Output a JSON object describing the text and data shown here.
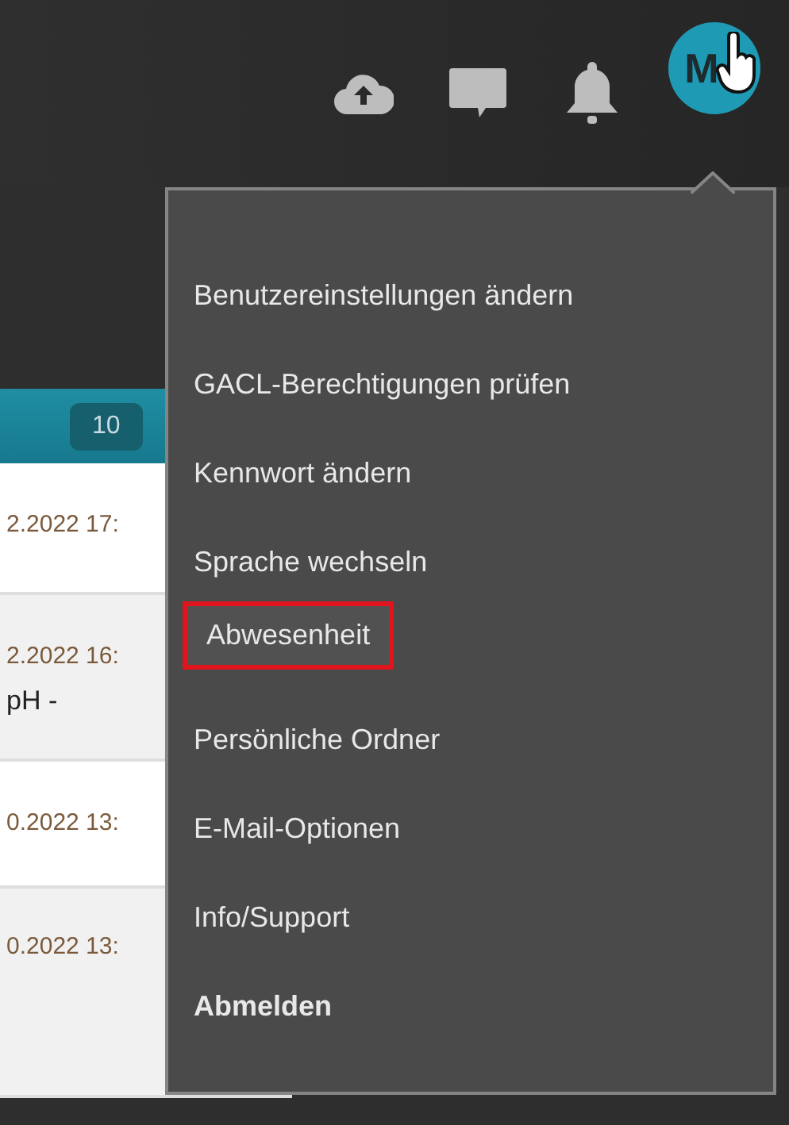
{
  "header": {
    "avatar": {
      "initial": "M"
    }
  },
  "list": {
    "badge": "10",
    "rows": [
      {
        "lines": [
          "2.2022 17:"
        ]
      },
      {
        "lines": [
          "2.2022 16:",
          "pH -"
        ]
      },
      {
        "lines": [
          "0.2022 13:"
        ]
      },
      {
        "lines": [
          "0.2022 13:"
        ]
      }
    ]
  },
  "user_menu": {
    "items": [
      {
        "label": "Benutzereinstellungen ändern",
        "kind": "item",
        "selected": false
      },
      {
        "label": "GACL-Berechtigungen prüfen",
        "kind": "item",
        "selected": false
      },
      {
        "label": "Kennwort ändern",
        "kind": "item",
        "selected": false
      },
      {
        "label": "Sprache wechseln",
        "kind": "item",
        "selected": false
      },
      {
        "label": "Abwesenheit",
        "kind": "item",
        "selected": true
      },
      {
        "label": "Persönliche Ordner",
        "kind": "item",
        "selected": false
      },
      {
        "label": "E-Mail-Optionen",
        "kind": "item",
        "selected": false
      },
      {
        "label": "Info/Support",
        "kind": "item",
        "selected": false
      },
      {
        "label": "Abmelden",
        "kind": "logout",
        "selected": false
      }
    ]
  }
}
